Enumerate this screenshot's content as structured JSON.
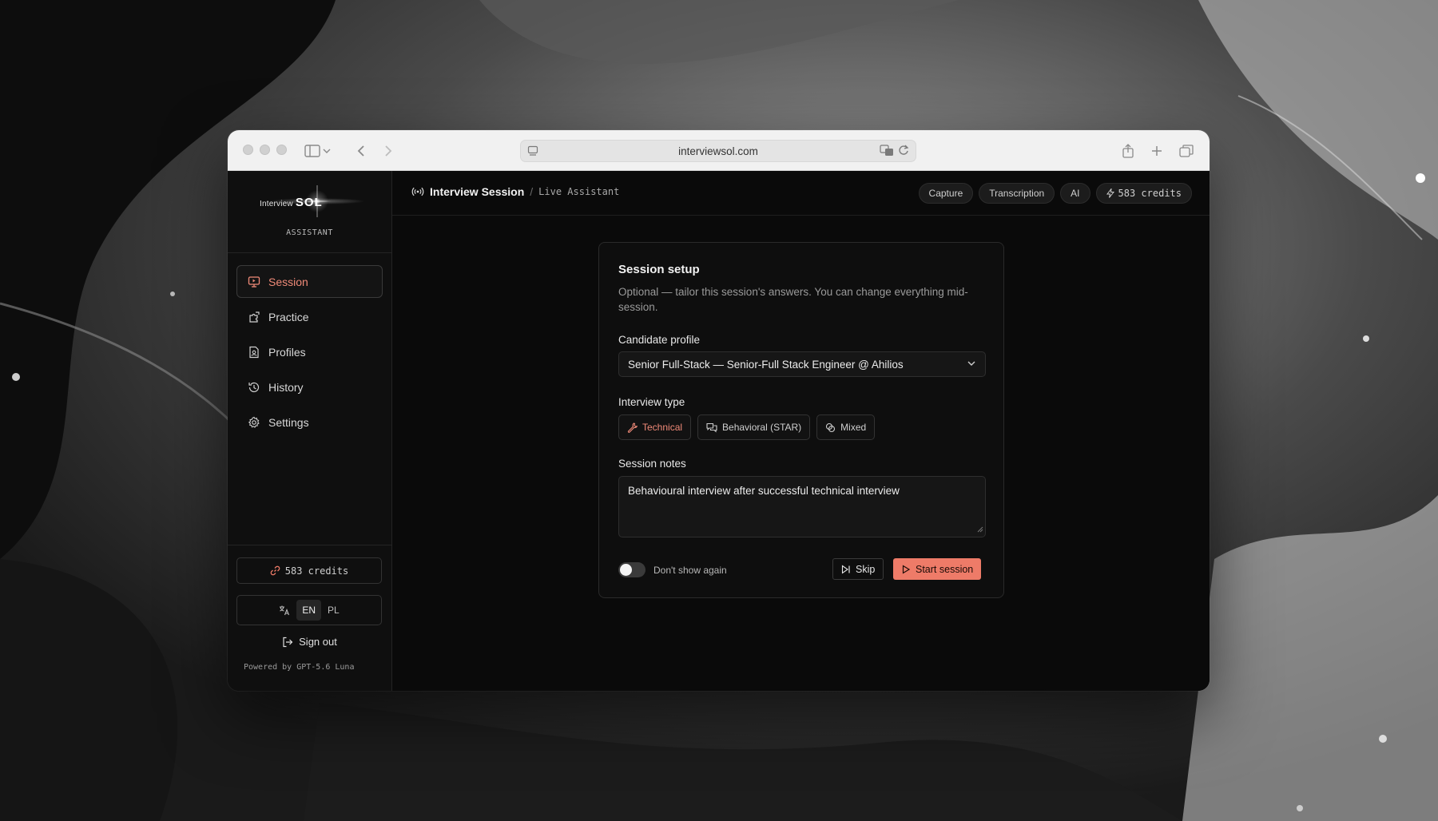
{
  "browser": {
    "url": "interviewsol.com"
  },
  "brand": {
    "logo_prefix": "Interview",
    "logo_main": "SOL",
    "subtitle": "ASSISTANT"
  },
  "sidebar": {
    "items": [
      {
        "label": "Session",
        "icon": "monitor-play-icon",
        "active": true
      },
      {
        "label": "Practice",
        "icon": "puzzle-icon",
        "active": false
      },
      {
        "label": "Profiles",
        "icon": "profile-doc-icon",
        "active": false
      },
      {
        "label": "History",
        "icon": "history-icon",
        "active": false
      },
      {
        "label": "Settings",
        "icon": "gear-icon",
        "active": false
      }
    ],
    "credits": "583 credits",
    "lang_en": "EN",
    "lang_pl": "PL",
    "sign_out": "Sign out",
    "powered_by": "Powered by GPT-5.6 Luna"
  },
  "header": {
    "title": "Interview Session",
    "separator": "/",
    "subtitle": "Live Assistant",
    "pills": {
      "capture": "Capture",
      "transcription": "Transcription",
      "ai": "AI",
      "credits": "583 credits"
    }
  },
  "setup": {
    "title": "Session setup",
    "description": "Optional — tailor this session's answers. You can change everything mid-session.",
    "profile_label": "Candidate profile",
    "profile_value": "Senior Full-Stack — Senior-Full Stack Engineer @ Ahilios",
    "type_label": "Interview type",
    "types": {
      "technical": "Technical",
      "behavioral": "Behavioral (STAR)",
      "mixed": "Mixed"
    },
    "selected_type": "Technical",
    "notes_label": "Session notes",
    "notes_value": "Behavioural interview after successful technical interview",
    "dont_show_again": "Don't show again",
    "skip": "Skip",
    "start": "Start session"
  },
  "colors": {
    "accent": "#ee7b68",
    "background": "#0a0a0a"
  }
}
